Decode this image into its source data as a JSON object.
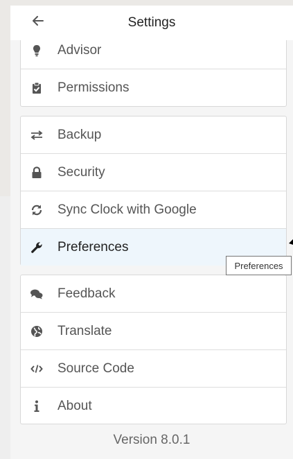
{
  "header": {
    "title": "Settings",
    "back_icon": "arrow-left-icon"
  },
  "groups": [
    {
      "items": [
        {
          "label": "Advisor",
          "icon": "lightbulb-icon"
        },
        {
          "label": "Permissions",
          "icon": "clipboard-check-icon"
        }
      ]
    },
    {
      "items": [
        {
          "label": "Backup",
          "icon": "exchange-icon"
        },
        {
          "label": "Security",
          "icon": "lock-icon"
        },
        {
          "label": "Sync Clock with Google",
          "icon": "sync-icon"
        },
        {
          "label": "Preferences",
          "icon": "wrench-icon",
          "active": true
        }
      ]
    },
    {
      "items": [
        {
          "label": "Feedback",
          "icon": "comments-icon"
        },
        {
          "label": "Translate",
          "icon": "globe-icon"
        },
        {
          "label": "Source Code",
          "icon": "code-icon"
        },
        {
          "label": "About",
          "icon": "info-icon"
        }
      ]
    }
  ],
  "tooltip": "Preferences",
  "footer": {
    "version": "Version 8.0.1"
  },
  "colors": {
    "active_row": "#eef6fc",
    "icon": "#555555",
    "background": "#f5f5f5"
  }
}
